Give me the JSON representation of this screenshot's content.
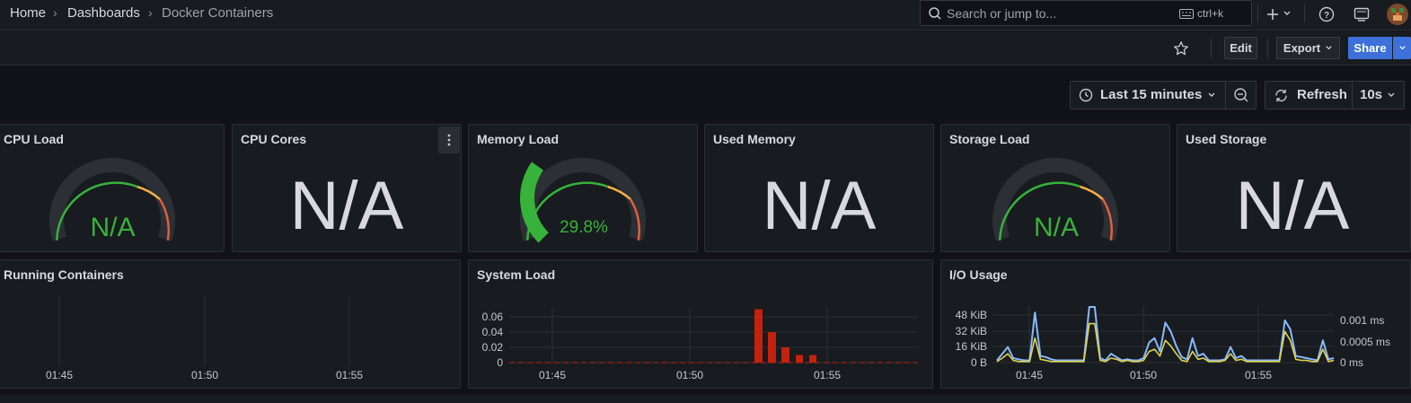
{
  "breadcrumb": {
    "home": "Home",
    "dashboards": "Dashboards",
    "current": "Docker Containers"
  },
  "search": {
    "placeholder": "Search or jump to...",
    "shortcut": "ctrl+k"
  },
  "toolbar": {
    "edit": "Edit",
    "export": "Export",
    "share": "Share"
  },
  "time": {
    "range": "Last 15 minutes",
    "refresh": "Refresh",
    "interval": "10s"
  },
  "icons": [
    "search-icon",
    "keyboard-icon",
    "plus-icon",
    "chevron-down-icon",
    "help-icon",
    "news-icon",
    "avatar",
    "star-icon",
    "clock-icon",
    "zoom-out-icon",
    "refresh-icon"
  ],
  "colors": {
    "accent": "#3d71d9",
    "gauge_green": "#37b23b",
    "series_blue": "#8ab8ff",
    "series_yellow": "#e0d54a",
    "bar_red": "#c4220f"
  },
  "panels": {
    "cpu_load": {
      "title": "CPU Load",
      "value": "N/A"
    },
    "cpu_cores": {
      "title": "CPU Cores",
      "value": "N/A"
    },
    "memory_load": {
      "title": "Memory Load",
      "value": "29.8%",
      "percent": 29.8
    },
    "used_memory": {
      "title": "Used Memory",
      "value": "N/A"
    },
    "storage_load": {
      "title": "Storage Load",
      "value": "N/A"
    },
    "used_storage": {
      "title": "Used Storage",
      "value": "N/A"
    },
    "running_containers": {
      "title": "Running Containers",
      "x_ticks": [
        "01:45",
        "01:50",
        "01:55"
      ]
    },
    "system_load": {
      "title": "System Load",
      "y_ticks": [
        "0.06",
        "0.04",
        "0.02",
        "0"
      ],
      "x_ticks": [
        "01:45",
        "01:50",
        "01:55"
      ]
    },
    "io_usage": {
      "title": "I/O Usage",
      "y_left_ticks": [
        "48 KiB",
        "32 KiB",
        "16 KiB",
        "0 B"
      ],
      "y_right_ticks": [
        "0.001 ms",
        "0.0005 ms",
        "0 ms"
      ],
      "x_ticks": [
        "01:45",
        "01:50",
        "01:55"
      ]
    }
  },
  "chart_data": [
    {
      "type": "bar",
      "title": "System Load",
      "ylim": [
        0,
        0.07
      ],
      "x": [
        "01:52:30",
        "01:53:00",
        "01:53:30",
        "01:54:00",
        "01:54:30"
      ],
      "values": [
        0.07,
        0.04,
        0.02,
        0.01,
        0.01
      ]
    },
    {
      "type": "line",
      "title": "I/O Usage",
      "series": [
        {
          "values": [
            2,
            8,
            14,
            4,
            3,
            2,
            2,
            45,
            6,
            5,
            3,
            2,
            2,
            2,
            2,
            2,
            2,
            50,
            50,
            4,
            2,
            8,
            5,
            2,
            3,
            2,
            2,
            4,
            18,
            22,
            10,
            36,
            28,
            15,
            5,
            3,
            22,
            6,
            8,
            2,
            2,
            2,
            3,
            14,
            4,
            6,
            2,
            2,
            2,
            2,
            2,
            2,
            2,
            38,
            30,
            6,
            5,
            4,
            3,
            2,
            20,
            3,
            4
          ]
        },
        {
          "values": [
            1,
            4,
            8,
            2,
            1,
            1,
            1,
            22,
            3,
            2,
            1,
            1,
            1,
            1,
            1,
            1,
            1,
            35,
            35,
            2,
            1,
            4,
            3,
            1,
            2,
            1,
            1,
            2,
            10,
            12,
            6,
            20,
            15,
            8,
            2,
            1,
            10,
            3,
            4,
            1,
            1,
            1,
            2,
            8,
            2,
            3,
            1,
            1,
            1,
            1,
            1,
            1,
            1,
            28,
            20,
            3,
            2,
            2,
            1,
            1,
            12,
            1,
            2
          ]
        }
      ]
    }
  ]
}
